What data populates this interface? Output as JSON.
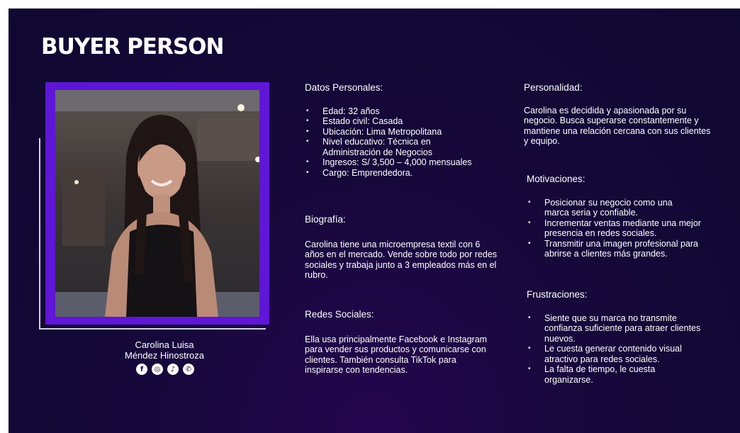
{
  "title": "BUYER PERSON",
  "persona": {
    "name_line1": "Carolina Luisa",
    "name_line2": "Méndez Hinostroza",
    "socials": [
      {
        "icon": "facebook-icon",
        "glyph": "f"
      },
      {
        "icon": "instagram-icon",
        "glyph": "◎"
      },
      {
        "icon": "tiktok-icon",
        "glyph": "♪"
      },
      {
        "icon": "whatsapp-icon",
        "glyph": "✆"
      }
    ]
  },
  "datos_personales": {
    "heading": "Datos Personales:",
    "items": [
      "Edad: 32 años",
      "Estado civil: Casada",
      "Ubicación: Lima Metropolitana",
      "Nivel educativo: Técnica en Administración de Negocios",
      "Ingresos: S/ 3,500 – 4,000 mensuales",
      "Cargo: Emprendedora."
    ]
  },
  "biografia": {
    "heading": "Biografía:",
    "text": "Carolina tiene una microempresa textil con 6 años en el mercado. Vende sobre todo por redes sociales y trabaja junto a 3 empleados más en el rubro."
  },
  "redes_sociales": {
    "heading": "Redes Sociales:",
    "text": "Ella usa principalmente Facebook e Instagram para vender sus productos y comunicarse con clientes. También consulta TikTok para inspirarse con tendencias."
  },
  "personalidad": {
    "heading": "Personalidad:",
    "text": "Carolina es decidida y apasionada por su negocio. Busca superarse constantemente y mantiene una relación cercana con sus clientes y equipo."
  },
  "motivaciones": {
    "heading": "Motivaciones:",
    "items": [
      "Posicionar su negocio como una marca seria y confiable.",
      "Incrementar ventas mediante una mejor presencia en redes sociales.",
      "Transmitir una imagen profesional para abrirse a clientes más grandes."
    ]
  },
  "frustraciones": {
    "heading": "Frustraciones:",
    "items": [
      "Siente que su marca no transmite confianza suficiente para atraer clientes nuevos.",
      "Le cuesta generar contenido visual atractivo para redes sociales.",
      "La falta de tiempo, le cuesta organizarse."
    ]
  },
  "colors": {
    "background": "#120834",
    "accent_purple": "#5f16d6",
    "text": "#ffffff"
  }
}
